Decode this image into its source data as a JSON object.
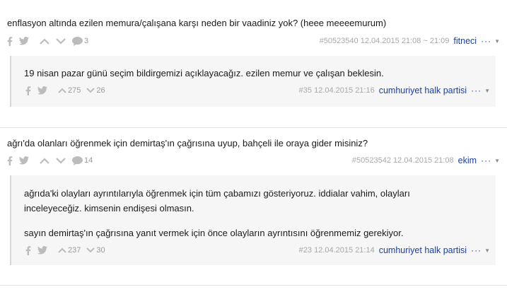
{
  "entries": [
    {
      "question": "enflasyon altında ezilen memura/çalışana karşı neden bir vaadiniz yok? (heee meeeemurum)",
      "comment_count": "3",
      "info": "#50523540 12.04.2015 21:08 ~ 21:09",
      "author": "fitneci",
      "more": "···",
      "reply": {
        "lines": [
          "19 nisan pazar günü seçim bildirgemizi açıklayacağız. ezilen memur ve çalışan beklesin."
        ],
        "up_count": "275",
        "down_count": "26",
        "info": "#35 12.04.2015 21:16",
        "author": "cumhuriyet halk partisi",
        "more": "···"
      }
    },
    {
      "question": "ağrı'da olanları öğrenmek için demirtaş'ın çağrısına uyup, bahçeli ile oraya gider misiniz?",
      "comment_count": "14",
      "info": "#50523542 12.04.2015 21:08",
      "author": "ekim",
      "more": "···",
      "reply": {
        "lines": [
          "ağrıda'ki olayları ayrıntılarıyla öğrenmek için tüm çabamızı gösteriyoruz. iddialar vahim, olayları",
          "inceleyeceğiz. kimsenin endişesi olmasın.",
          "",
          "sayın demirtaş'ın çağrısına yanıt vermek için önce olayların ayrıntısını öğrenmemiz gerekiyor."
        ],
        "up_count": "237",
        "down_count": "30",
        "info": "#23 12.04.2015 21:14",
        "author": "cumhuriyet halk partisi",
        "more": "···"
      }
    }
  ],
  "icons": {
    "facebook": "facebook-icon",
    "twitter": "twitter-icon",
    "upvote": "chevron-up-icon",
    "downvote": "chevron-down-icon",
    "comments": "speech-bubble-icon",
    "caret": "caret-down-icon"
  },
  "colors": {
    "author_link": "#1a3ea8",
    "muted_icon": "#bcbcbc",
    "reply_bg": "#f6f6f6"
  }
}
